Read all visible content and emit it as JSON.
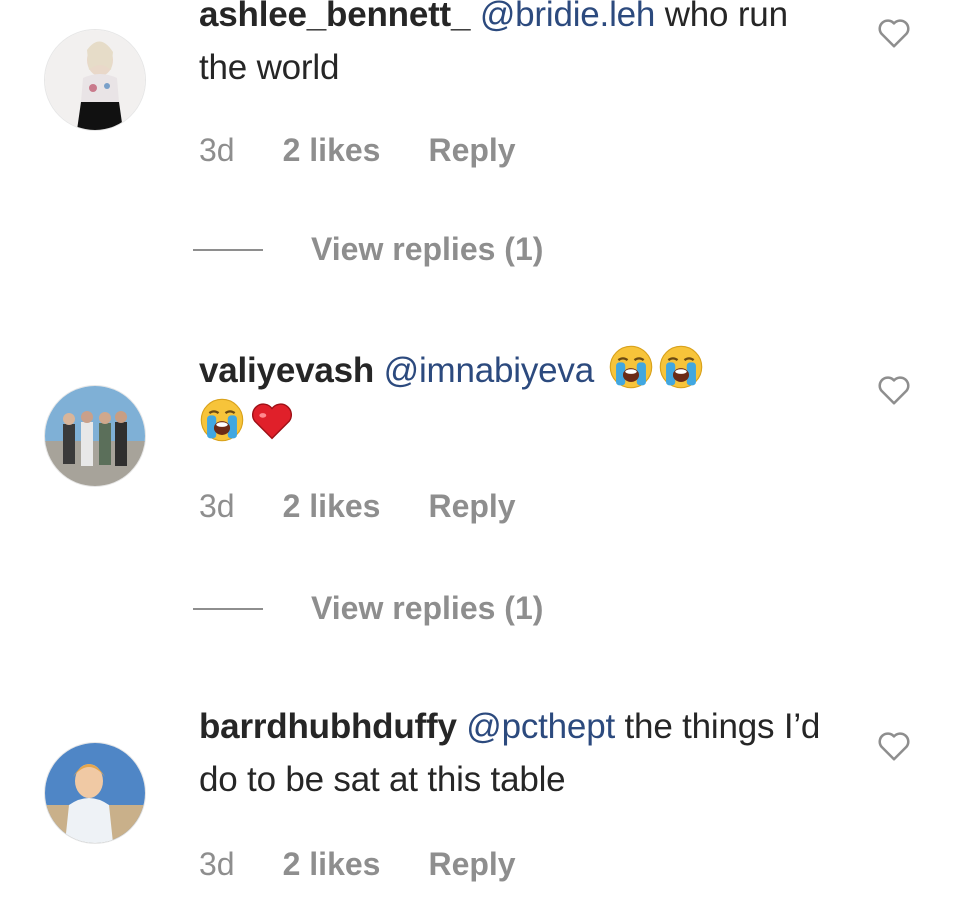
{
  "comments": [
    {
      "username": "ashlee_bennett_",
      "mention": "@bridie.leh",
      "text": " who run the world",
      "emojis": [],
      "time": "3d",
      "likes": "2 likes",
      "reply_label": "Reply",
      "view_replies": "View replies (1)"
    },
    {
      "username": "valiyevash",
      "mention": "@imnabiyeva",
      "text": "",
      "emojis": [
        "loudly-crying-face",
        "loudly-crying-face",
        "loudly-crying-face",
        "red-heart"
      ],
      "time": "3d",
      "likes": "2 likes",
      "reply_label": "Reply",
      "view_replies": "View replies (1)"
    },
    {
      "username": "barrdhubhduffy",
      "mention": "@pcthept",
      "text": " the things I’d do to be sat at this table",
      "emojis": [],
      "time": "3d",
      "likes": "2 likes",
      "reply_label": "Reply"
    }
  ],
  "colors": {
    "text": "#262626",
    "mention": "#2c4a7e",
    "meta": "#8e8e8e"
  },
  "icons": {
    "like": "heart-outline-icon"
  }
}
